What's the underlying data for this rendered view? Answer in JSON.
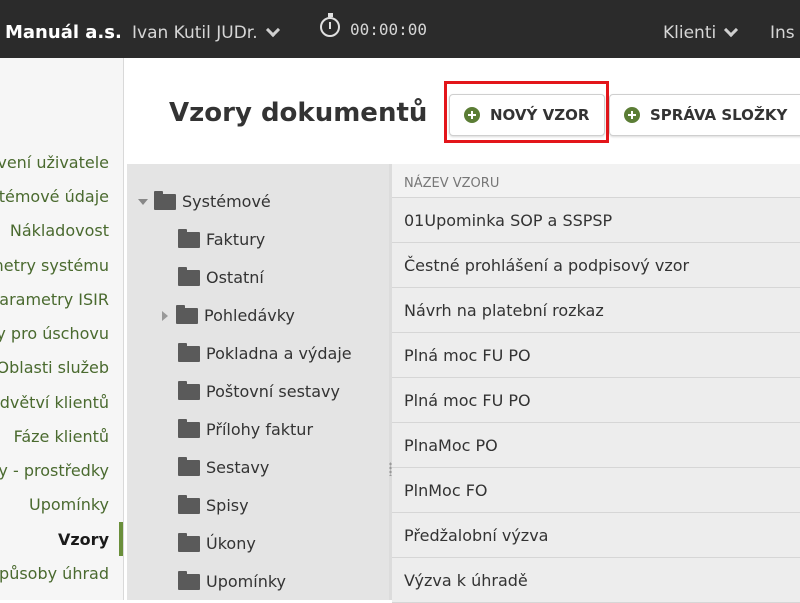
{
  "topbar": {
    "brand": "Manuál a.s.",
    "user": "Ivan Kutil JUDr.",
    "timer": "00:00:00",
    "klienti": "Klienti",
    "ins": "Ins"
  },
  "sidebar": {
    "items": [
      "vení uživatele",
      "stémové údaje",
      "Nákladovost",
      "metry systému",
      "arametry ISIR",
      "y pro úschovu",
      "Oblasti služeb",
      "dvětví klientů",
      "Fáze klientů",
      "y - prostředky",
      "Upomínky",
      "Vzory",
      "působy úhrad"
    ],
    "active_index": 11
  },
  "page": {
    "title": "Vzory dokumentů",
    "new_button": "NOVÝ VZOR",
    "folder_button": "SPRÁVA SLOŽKY"
  },
  "tree": {
    "root": "Systémové",
    "children": [
      "Faktury",
      "Ostatní",
      "Pohledávky",
      "Pokladna a výdaje",
      "Poštovní sestavy",
      "Přílohy faktur",
      "Sestavy",
      "Spisy",
      "Úkony",
      "Upomínky"
    ]
  },
  "list": {
    "header": "NÁZEV VZORU",
    "rows": [
      "01Upominka SOP a SSPSP",
      "Čestné prohlášení a podpisový vzor",
      "Návrh na platební rozkaz",
      "Plná moc FU PO",
      "Plná moc FU PO",
      "PlnaMoc PO",
      "PlnMoc FO",
      "Předžalobní výzva",
      "Výzva k úhradě"
    ]
  },
  "colors": {
    "topbar_bg": "#2b2b2b",
    "accent_green": "#5b7d35",
    "highlight_red": "#e3151a"
  }
}
